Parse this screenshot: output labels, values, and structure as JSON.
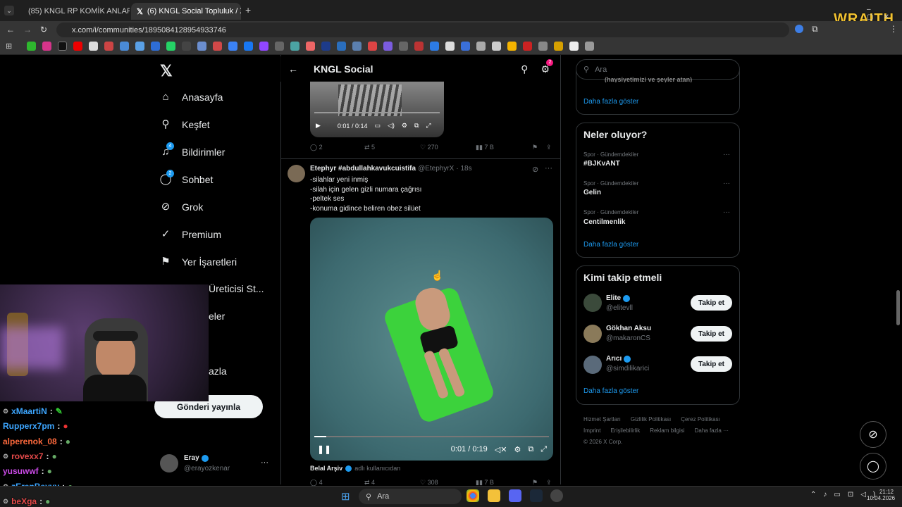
{
  "browser": {
    "tabs": [
      {
        "label": "(85) KNGL RP KOMİK ANLAR 4.",
        "close": "✕"
      },
      {
        "label": "(6) KNGL Social Topluluk / X",
        "close": "✕"
      }
    ],
    "new_tab": "+",
    "url": "x.com/i/communities/1895084128954933746",
    "overlay_logo": "WRAITH"
  },
  "nav": {
    "items": [
      {
        "label": "Anasayfa",
        "icon": "home-icon",
        "glyph": "⌂"
      },
      {
        "label": "Keşfet",
        "icon": "search-icon",
        "glyph": "⚲"
      },
      {
        "label": "Bildirimler",
        "icon": "bell-icon",
        "glyph": "♫",
        "badge": "4"
      },
      {
        "label": "Sohbet",
        "icon": "chat-icon",
        "glyph": "◯",
        "badge": "2"
      },
      {
        "label": "Grok",
        "icon": "grok-icon",
        "glyph": "⊘"
      },
      {
        "label": "Premium",
        "icon": "premium-icon",
        "glyph": "✓"
      },
      {
        "label": "Yer İşaretleri",
        "icon": "bookmark-icon",
        "glyph": "⚑"
      }
    ],
    "partial_items": [
      "Üreticisi St...",
      "eler",
      "azla"
    ],
    "post_button": "Gönderi yayınla",
    "account": {
      "name": "Eray",
      "handle": "@erayozkenar",
      "more": "···"
    }
  },
  "community": {
    "title": "KNGL Social",
    "settings_badge": "2"
  },
  "tweet1": {
    "video_time": "0:01 / 0:14",
    "replies": "2",
    "retweets": "5",
    "likes": "270",
    "views": "7 B"
  },
  "tweet2": {
    "author": "Etephyr #abdullahkavukcuistifa",
    "handle": "@EtephyrX",
    "time": "· 18s",
    "lines": [
      "-silahlar yeni inmiş",
      "-silah için gelen gizli numara çağrısı",
      "-peltek ses",
      "-konuma gidince beliren obez silüet"
    ],
    "video_time": "0:01 / 0:19",
    "video_progress": 0.05
  },
  "tweet3": {
    "author": "Belal Arşiv",
    "handle": "adlı kullanıcıdan",
    "replies": "4",
    "retweets": "4",
    "likes": "308",
    "views": "7 B"
  },
  "right": {
    "search_placeholder": "Ara",
    "top_partial": "(haysiyetimizi ve şeyler atan)",
    "show_more": "Daha fazla göster",
    "trends_title": "Neler oluyor?",
    "trends": [
      {
        "category": "Spor · Gündemdekiler",
        "name": "#BJKvANT"
      },
      {
        "category": "Spor · Gündemdekiler",
        "name": "Gelin"
      },
      {
        "category": "Spor · Gündemdekiler",
        "name": "Centilmenlik"
      }
    ],
    "follow_title": "Kimi takip etmeli",
    "follow": [
      {
        "name": "Elite",
        "handle": "@elitevll",
        "verified": true
      },
      {
        "name": "Gökhan Aksu",
        "handle": "@makaronCS",
        "verified": false
      },
      {
        "name": "Arıcı",
        "handle": "@simdilikarici",
        "verified": true
      }
    ],
    "follow_label": "Takip et",
    "footer": [
      "Hizmet Şartları",
      "Gizlilik Politikası",
      "Çerez Politikası",
      "Imprint",
      "Erişilebilirlik",
      "Reklam bilgisi",
      "Daha fazla ···",
      "© 2026 X Corp."
    ]
  },
  "chat": [
    {
      "user": "xMaartiN",
      "sep": ":",
      "color": "#3da6ff"
    },
    {
      "user": "Rupperx7pm",
      "sep": ":",
      "color": "#3da6ff"
    },
    {
      "user": "alperenok_08",
      "sep": ":",
      "color": "#ff6a3d"
    },
    {
      "user": "rovexx7",
      "sep": ":",
      "color": "#e64a4a"
    },
    {
      "user": "yusuwwf",
      "sep": ":",
      "color": "#c94ae6"
    },
    {
      "user": "zErenBeyyy",
      "sep": ":",
      "color": "#3da6ff"
    },
    {
      "user": "beXga",
      "sep": ":",
      "color": "#e64a4a"
    }
  ],
  "taskbar": {
    "search": "Ara",
    "time": "21:12",
    "date": "10.04.2026"
  }
}
